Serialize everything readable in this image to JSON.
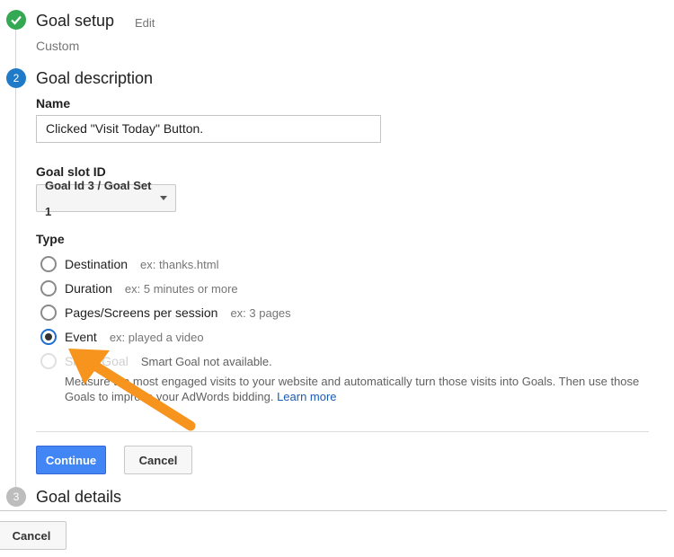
{
  "steps": {
    "setup": {
      "title": "Goal setup",
      "edit": "Edit",
      "value": "Custom"
    },
    "description": {
      "number": "2",
      "title": "Goal description"
    },
    "details": {
      "number": "3",
      "title": "Goal details"
    }
  },
  "form": {
    "name_label": "Name",
    "name_value": "Clicked \"Visit Today\" Button.",
    "slot_label": "Goal slot ID",
    "slot_value": "Goal Id 3 / Goal Set 1",
    "type_label": "Type"
  },
  "types": [
    {
      "label": "Destination",
      "hint": "ex: thanks.html",
      "checked": false
    },
    {
      "label": "Duration",
      "hint": "ex: 5 minutes or more",
      "checked": false
    },
    {
      "label": "Pages/Screens per session",
      "hint": "ex: 3 pages",
      "checked": false
    },
    {
      "label": "Event",
      "hint": "ex: played a video",
      "checked": true
    },
    {
      "label": "Smart Goal",
      "hint": "Smart Goal not available.",
      "checked": false,
      "disabled": true
    }
  ],
  "smart_goal_desc": {
    "line1": "Measure the most engaged visits to your website and automatically turn those visits into Goals. Then use those",
    "line2": "Goals to improve your AdWords bidding.",
    "link": "Learn more"
  },
  "buttons": {
    "continue": "Continue",
    "cancel": "Cancel",
    "bottom_cancel": "Cancel"
  },
  "colors": {
    "check_green": "#34a853",
    "step_blue": "#1f7ac7",
    "step_gray": "#bdbdbd",
    "arrow_orange": "#f7941d",
    "primary_button": "#4285f4"
  }
}
